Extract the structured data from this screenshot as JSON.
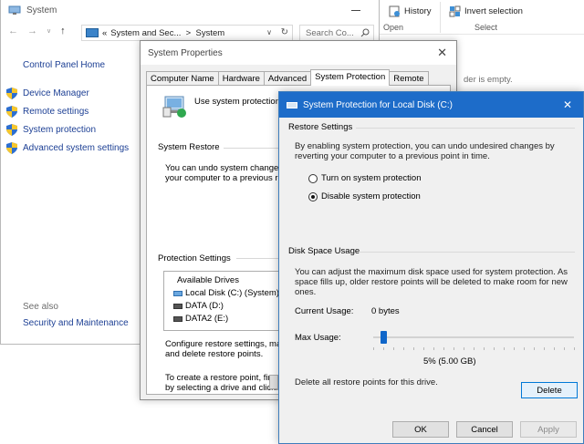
{
  "ribbon": {
    "history_label": "History",
    "invert_label": "Invert selection",
    "open_group": "Open",
    "select_group": "Select",
    "empty_text": "der is empty."
  },
  "system_window": {
    "title": "System",
    "address": "System and Sec...  >  System",
    "address_prefix": "«",
    "search_placeholder": "Search Co...",
    "control_panel_home": "Control Panel Home",
    "links": [
      "Device Manager",
      "Remote settings",
      "System protection",
      "Advanced system settings"
    ],
    "see_also": "See also",
    "security_maintenance": "Security and Maintenance"
  },
  "system_properties": {
    "title": "System Properties",
    "tabs": [
      "Computer Name",
      "Hardware",
      "Advanced",
      "System Protection",
      "Remote"
    ],
    "active_tab": "System Protection",
    "intro": "Use system protection to",
    "system_restore_label": "System Restore",
    "system_restore_text_1": "You can undo system changes b",
    "system_restore_text_2": "your computer to a previous res",
    "protection_settings_label": "Protection Settings",
    "available_drives_header": "Available Drives",
    "drives": [
      "Local Disk (C:) (System)",
      "DATA (D:)",
      "DATA2 (E:)"
    ],
    "configure_1": "Configure restore settings, mana",
    "configure_2": "and delete restore points.",
    "create_1": "To create a restore point, first er",
    "create_2": "by selecting a drive and clicking"
  },
  "protection_dialog": {
    "title": "System Protection for Local Disk (C:)",
    "restore_settings_label": "Restore Settings",
    "restore_desc_1": "By enabling system protection, you can undo undesired changes by",
    "restore_desc_2": "reverting your computer to a previous point in time.",
    "radio_on": "Turn on system protection",
    "radio_off": "Disable system protection",
    "selected_option": "Disable system protection",
    "disk_usage_label": "Disk Space Usage",
    "disk_desc_1": "You can adjust the maximum disk space used for system protection. As",
    "disk_desc_2": "space fills up, older restore points will be deleted to make room for new",
    "disk_desc_3": "ones.",
    "current_usage_label": "Current Usage:",
    "current_usage_value": "0 bytes",
    "max_usage_label": "Max Usage:",
    "max_usage_fraction": 0.05,
    "max_usage_display": "5% (5.00 GB)",
    "delete_desc": "Delete all restore points for this drive.",
    "delete_button": "Delete",
    "ok_button": "OK",
    "cancel_button": "Cancel",
    "apply_button": "Apply"
  },
  "colors": {
    "title_bar_blue": "#1d6cc9",
    "link_blue": "#1c3f94",
    "slider_thumb": "#0f66c9"
  }
}
